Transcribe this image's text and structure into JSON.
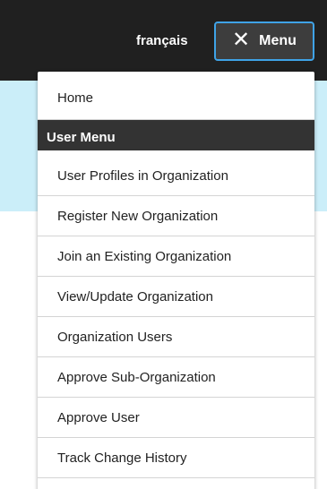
{
  "header": {
    "language_link": "français",
    "menu_button_label": "Menu",
    "menu_close_icon": "close-icon"
  },
  "menu": {
    "home": "Home",
    "section_title": "User Menu",
    "items": [
      "User Profiles in Organization",
      "Register New Organization",
      "Join an Existing Organization",
      "View/Update Organization",
      "Organization Users",
      "Approve Sub-Organization",
      "Approve User",
      "Track Change History"
    ]
  },
  "colors": {
    "topbar": "#202020",
    "banner": "#cbeef9",
    "focus_ring": "#3fa3e7",
    "section_bg": "#333333"
  }
}
